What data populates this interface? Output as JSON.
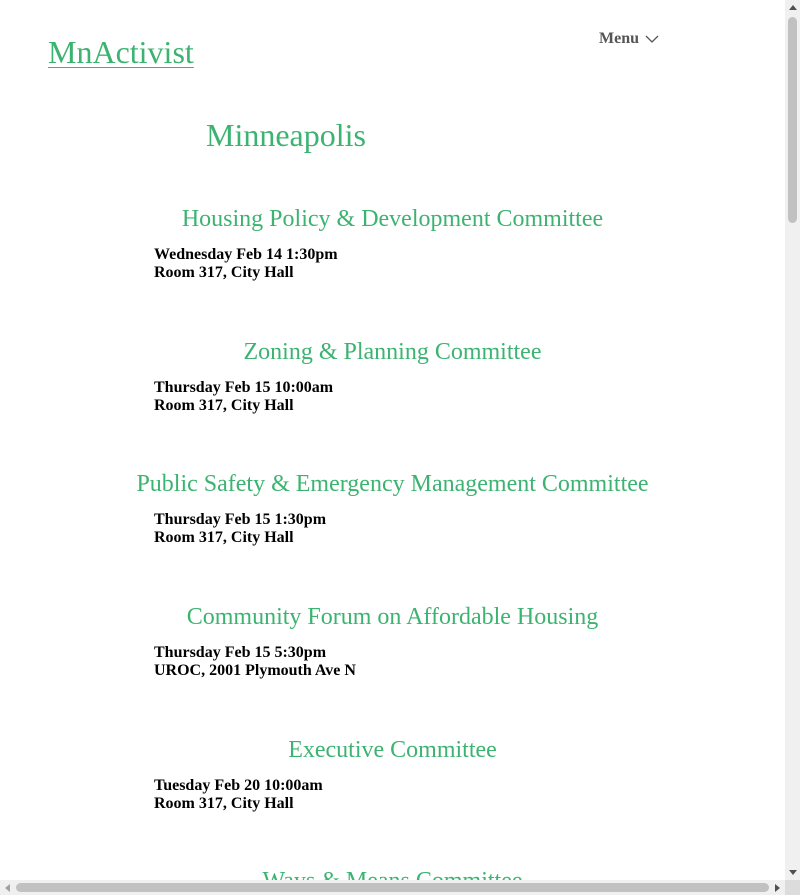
{
  "header": {
    "site_title": "MnActivist",
    "menu_label": "Menu"
  },
  "page": {
    "city": "Minneapolis"
  },
  "events": [
    {
      "title": "Housing Policy & Development Committee",
      "datetime": "Wednesday Feb 14 1:30pm",
      "location": "Room 317, City Hall"
    },
    {
      "title": "Zoning & Planning Committee",
      "datetime": "Thursday Feb 15 10:00am",
      "location": "Room 317, City Hall"
    },
    {
      "title": "Public Safety & Emergency Management Committee",
      "datetime": "Thursday Feb 15 1:30pm",
      "location": "Room 317, City Hall"
    },
    {
      "title": "Community Forum on Affordable Housing",
      "datetime": "Thursday Feb 15 5:30pm",
      "location": "UROC, 2001 Plymouth Ave N"
    },
    {
      "title": "Executive Committee",
      "datetime": "Tuesday Feb 20 10:00am",
      "location": "Room 317, City Hall"
    },
    {
      "title": "Ways & Means Committee",
      "datetime": "",
      "location": ""
    }
  ],
  "colors": {
    "accent": "#3cb371",
    "menu_text": "#555555"
  },
  "icons": {
    "menu": "chevron-down-icon"
  }
}
